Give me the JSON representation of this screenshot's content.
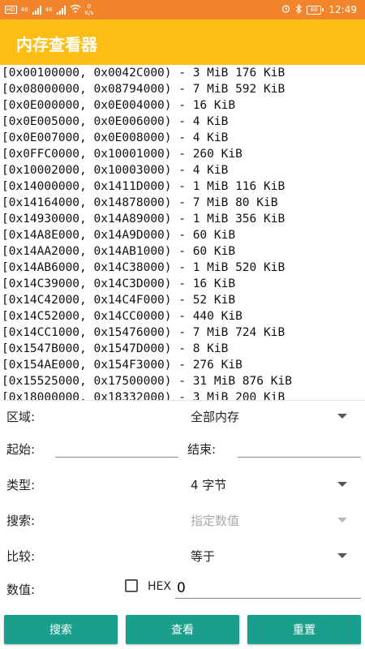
{
  "status_bar": {
    "left_badges": [
      "HD",
      "46",
      "46",
      "HD"
    ],
    "net_speed_value": "0",
    "net_speed_unit": "K/s",
    "battery": "60",
    "time": "12:49"
  },
  "app": {
    "title": "内存查看器"
  },
  "memory_map": [
    "[0x00100000, 0x0042C000) - 3 MiB 176 KiB",
    "[0x08000000, 0x08794000) - 7 MiB 592 KiB",
    "[0x0E000000, 0x0E004000) - 16 KiB",
    "[0x0E005000, 0x0E006000) - 4 KiB",
    "[0x0E007000, 0x0E008000) - 4 KiB",
    "[0x0FFC0000, 0x10001000) - 260 KiB",
    "[0x10002000, 0x10003000) - 4 KiB",
    "[0x14000000, 0x1411D000) - 1 MiB 116 KiB",
    "[0x14164000, 0x14878000) - 7 MiB 80 KiB",
    "[0x14930000, 0x14A89000) - 1 MiB 356 KiB",
    "[0x14A8E000, 0x14A9D000) - 60 KiB",
    "[0x14AA2000, 0x14AB1000) - 60 KiB",
    "[0x14AB6000, 0x14C38000) - 1 MiB 520 KiB",
    "[0x14C39000, 0x14C3D000) - 16 KiB",
    "[0x14C42000, 0x14C4F000) - 52 KiB",
    "[0x14C52000, 0x14CC0000) - 440 KiB",
    "[0x14CC1000, 0x15476000) - 7 MiB 724 KiB",
    "[0x1547B000, 0x1547D000) - 8 KiB",
    "[0x154AE000, 0x154F3000) - 276 KiB",
    "[0x15525000, 0x17500000) - 31 MiB 876 KiB",
    "[0x18000000, 0x18332000) - 3 MiB 200 KiB"
  ],
  "form": {
    "region_label": "区域:",
    "region_value": "全部内存",
    "start_label": "起始:",
    "start_value": "",
    "end_label": "结束:",
    "end_value": "",
    "type_label": "类型:",
    "type_value": "4 字节",
    "search_label": "搜索:",
    "search_value": "指定数值",
    "compare_label": "比较:",
    "compare_value": "等于",
    "value_label": "数值:",
    "hex_label": "HEX",
    "value_input": "0"
  },
  "buttons": {
    "search": "搜索",
    "view": "查看",
    "reset": "重置"
  },
  "colors": {
    "status_bar": "#f2852b",
    "app_bar": "#fdbd14",
    "button": "#199f8b"
  }
}
